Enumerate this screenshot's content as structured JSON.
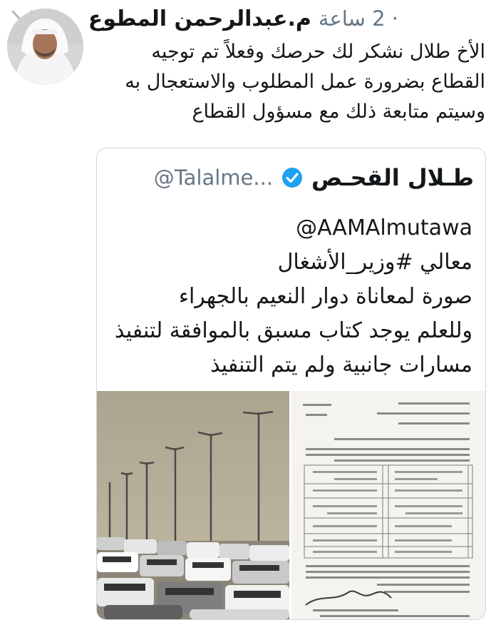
{
  "tweet": {
    "author_name": "م.عبدالرحمن المطوع",
    "time": "2 ساعة",
    "text_lines": [
      "الأخ طلال نشكر لك حرصك وفعلاً تم توجيه",
      "القطاع بضرورة عمل المطلوب والاستعجال به",
      "وسيتم متابعة ذلك مع مسؤول القطاع"
    ]
  },
  "quoted": {
    "name": "طـلال القحـص",
    "handle": "@Talalme...",
    "lines": [
      "@AAMAlmutawa",
      "معالي #وزير_الأشغال",
      "صورة لمعاناة دوار النعيم بالجهراء",
      "وللعلم يوجد كتاب مسبق بالموافقة لتنفيذ",
      "مسارات جانبية ولم يتم التنفيذ"
    ]
  },
  "icons": {
    "chevron": "chevron-down-icon",
    "verified": "verified-badge-icon"
  },
  "colors": {
    "text": "#14171a",
    "secondary": "#657786",
    "verified": "#1da1f2",
    "border": "#ccd6dd"
  }
}
